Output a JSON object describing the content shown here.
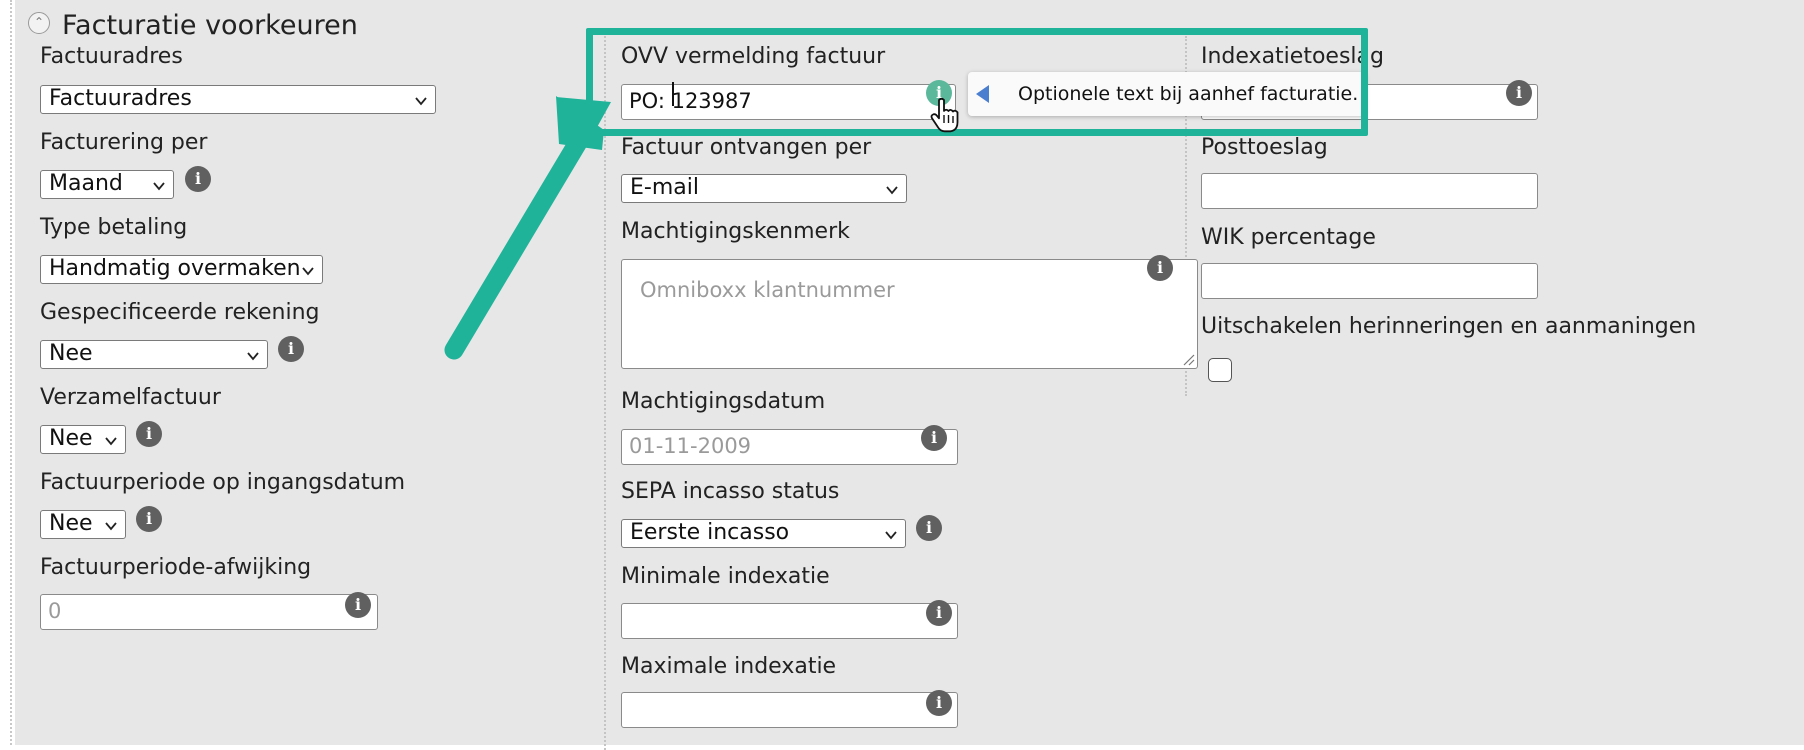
{
  "section": {
    "title": "Facturatie voorkeuren"
  },
  "col1": {
    "factuuradres": {
      "label": "Factuuradres",
      "value": "Factuuradres"
    },
    "facturering_per": {
      "label": "Facturering per",
      "value": "Maand"
    },
    "type_betaling": {
      "label": "Type betaling",
      "value": "Handmatig overmaken"
    },
    "gespecificeerde_rekening": {
      "label": "Gespecificeerde rekening",
      "value": "Nee"
    },
    "verzamelfactuur": {
      "label": "Verzamelfactuur",
      "value": "Nee"
    },
    "factuurperiode_ingangsdatum": {
      "label": "Factuurperiode op ingangsdatum",
      "value": "Nee"
    },
    "factuurperiode_afwijking": {
      "label": "Factuurperiode-afwijking",
      "placeholder": "0"
    }
  },
  "col2": {
    "ovv": {
      "label": "OVV vermelding factuur",
      "prefix": "PO: ",
      "value": "123987"
    },
    "factuur_ontvangen_per": {
      "label": "Factuur ontvangen per",
      "value": "E-mail"
    },
    "machtigingskenmerk": {
      "label": "Machtigingskenmerk",
      "placeholder": "Omniboxx klantnummer"
    },
    "machtigingsdatum": {
      "label": "Machtigingsdatum",
      "placeholder": "01-11-2009"
    },
    "sepa_status": {
      "label": "SEPA incasso status",
      "value": "Eerste incasso"
    },
    "minimale_indexatie": {
      "label": "Minimale indexatie"
    },
    "maximale_indexatie": {
      "label": "Maximale indexatie"
    }
  },
  "col3": {
    "indexatietoeslag": {
      "label": "Indexatietoeslag"
    },
    "posttoeslag": {
      "label": "Posttoeslag"
    },
    "wik_percentage": {
      "label": "WIK percentage"
    },
    "uitschakelen": {
      "label": "Uitschakelen herinneringen en aanmaningen",
      "checked": false
    }
  },
  "tooltip": {
    "text": "Optionele text bij aanhef facturatie."
  },
  "icons": {
    "info": "info-icon",
    "chevron": "chevron-down-icon",
    "collapse": "collapse-icon",
    "cursor": "hand-pointer-icon"
  },
  "colors": {
    "panel": "#e7e7e7",
    "annotation": "#1fb39a",
    "info_active": "#5bb89b",
    "info": "#606060"
  }
}
